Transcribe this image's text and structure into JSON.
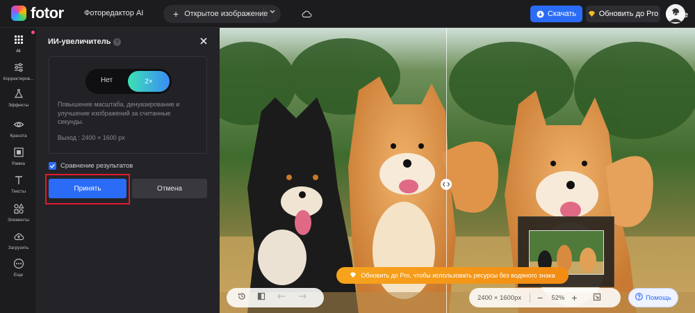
{
  "header": {
    "logo_text": "fotor",
    "app_title": "Фоторедактор AI",
    "open_image_label": "Открытое изображение",
    "download_label": "Скачать",
    "pro_label": "Обновить до Pro",
    "user_name": "Ekate"
  },
  "sidebar": {
    "items": [
      {
        "label": "AI",
        "icon": "ai-grid-icon"
      },
      {
        "label": "Корректиров...",
        "icon": "sliders-icon"
      },
      {
        "label": "Эффекты",
        "icon": "flask-icon"
      },
      {
        "label": "Красота",
        "icon": "eye-icon"
      },
      {
        "label": "Рамка",
        "icon": "frame-icon"
      },
      {
        "label": "Тексты",
        "icon": "text-icon"
      },
      {
        "label": "Элементы",
        "icon": "shapes-icon"
      },
      {
        "label": "Загрузить",
        "icon": "upload-icon"
      },
      {
        "label": "Еще",
        "icon": "more-icon"
      }
    ]
  },
  "panel": {
    "title": "ИИ-увеличитель",
    "toggle_off": "Нет",
    "toggle_on": "2×",
    "description": "Повышение масштаба, денуазирование и улучшение изображений за считанные секунды.",
    "output": "Выход : 2400 × 1600 px",
    "compare_label": "Сравнение результатов",
    "compare_checked": true,
    "apply_label": "Принять",
    "cancel_label": "Отмена"
  },
  "canvas": {
    "pro_banner": "Обновить до Pro, чтобы использовать ресурсы без водяного знака",
    "image_size": "2400 × 1600px",
    "zoom": "52%",
    "help_label": "Помощь"
  },
  "colors": {
    "accent": "#2b6cf6",
    "highlight": "#e01b2d",
    "banner": "#f7a41d"
  }
}
